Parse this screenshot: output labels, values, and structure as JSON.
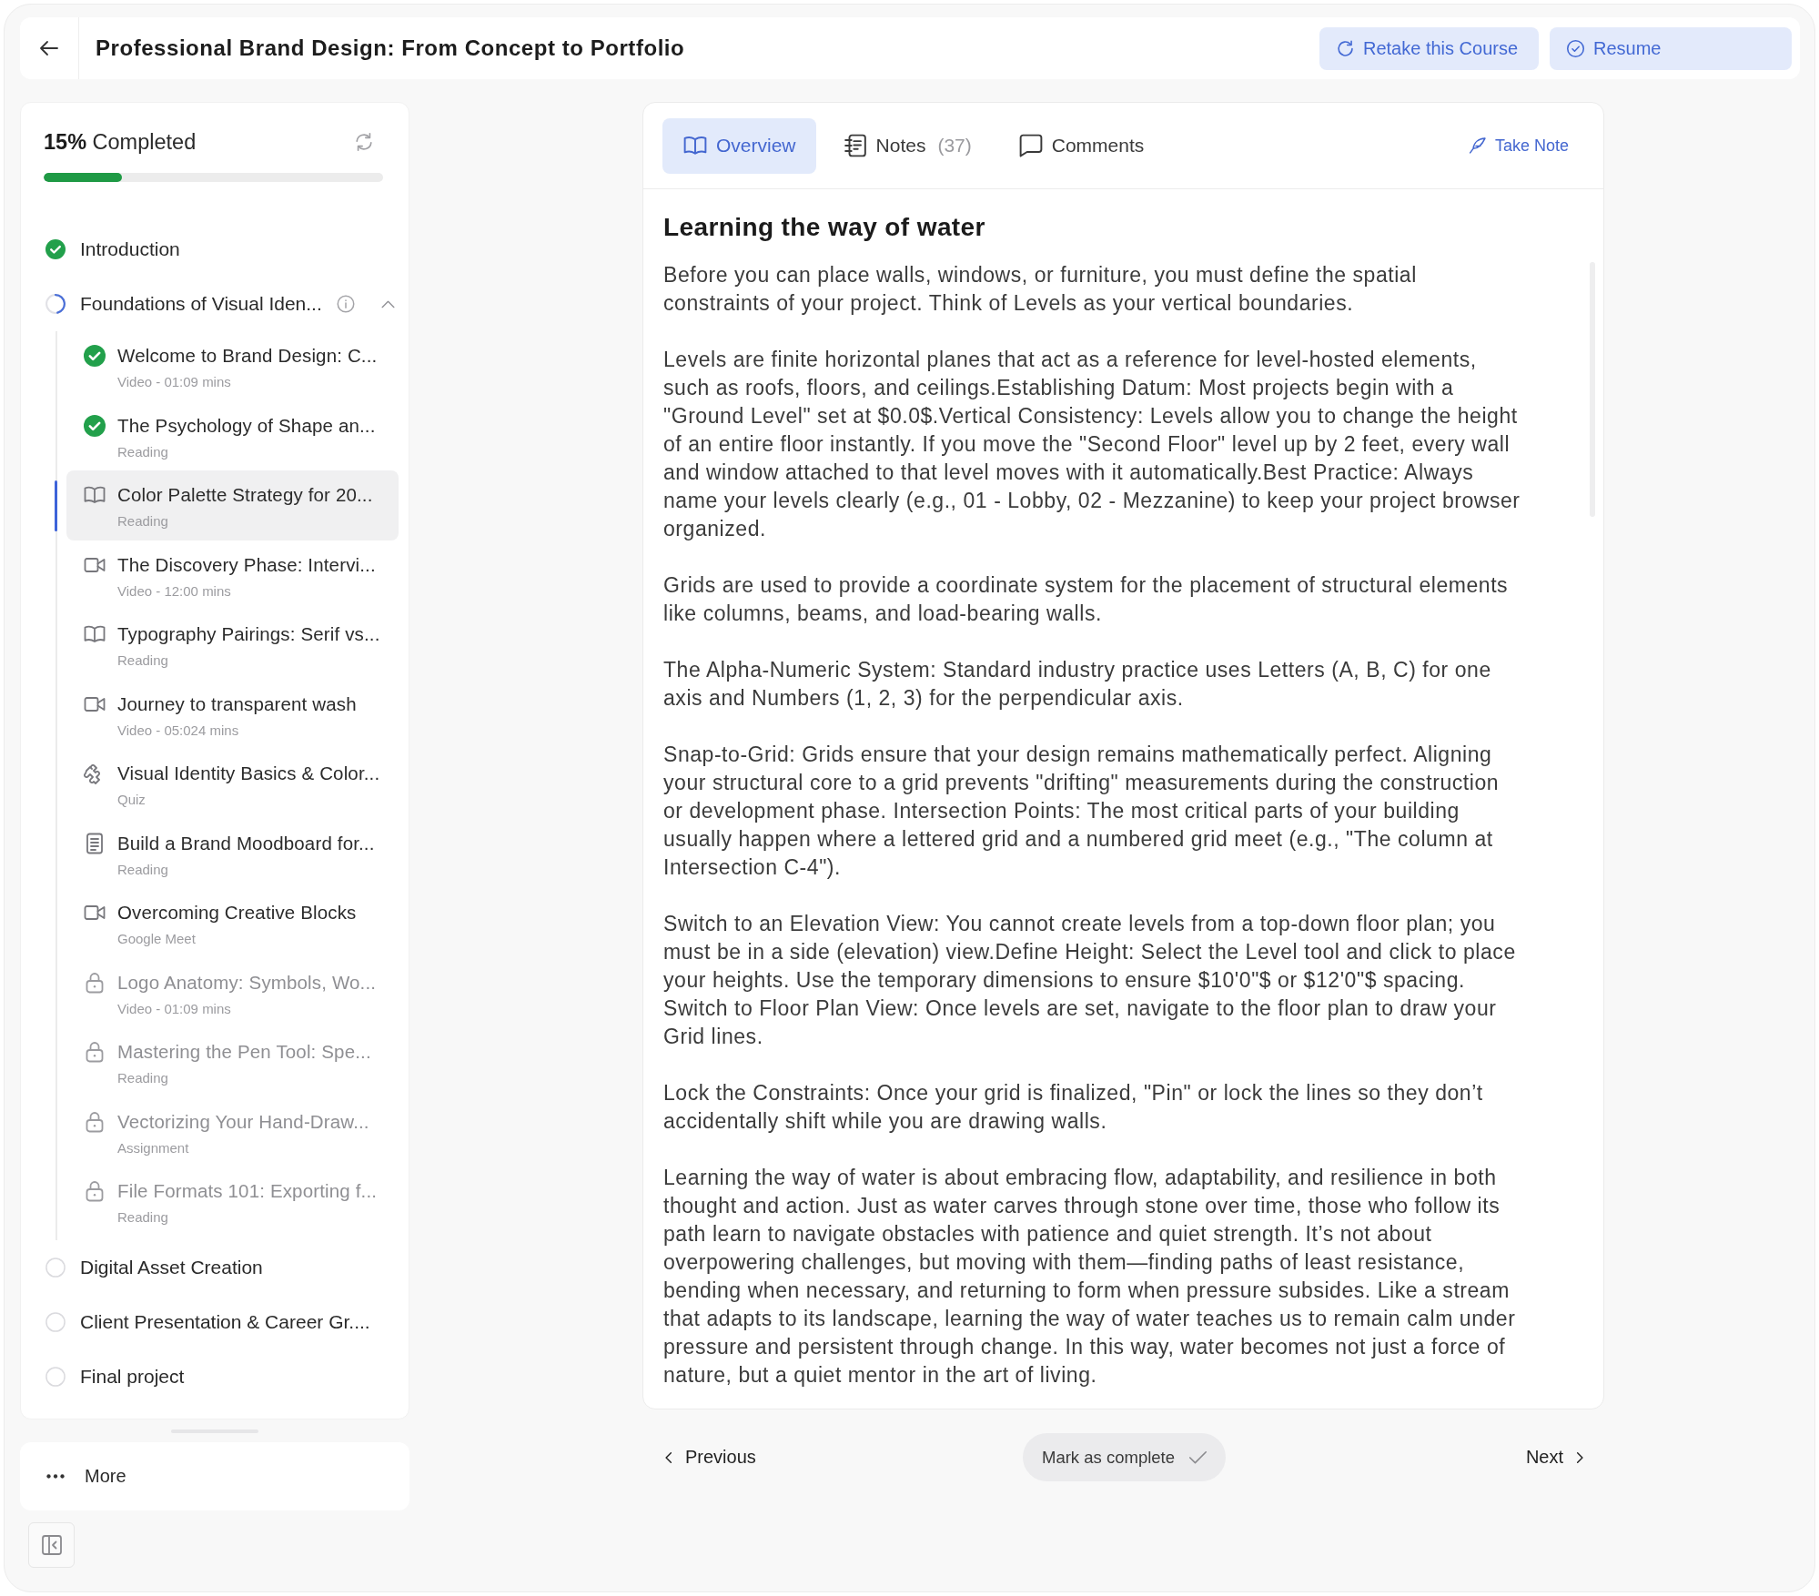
{
  "header": {
    "title": "Professional Brand Design: From Concept to Portfolio",
    "buttons": [
      "Retake this Course",
      "Resume"
    ]
  },
  "sidebar": {
    "progress": {
      "label": "**15%** Completed",
      "level": 0.23
    },
    "modules": [
      {
        "title": "Introduction",
        "kind": "complete"
      },
      {
        "title": "Foundations of Visual Iden...",
        "kind": "partial",
        "expanded": true,
        "lessons": [
          {
            "title": "Welcome to Brand Design: C...",
            "meta": "Video - 01:09 mins",
            "completed": true,
            "locked": false,
            "selected": false
          },
          {
            "title": "The Psychology of Shape an...",
            "meta": "Reading",
            "completed": true,
            "locked": false,
            "selected": false
          },
          {
            "title": "Color Palette Strategy for 20...",
            "meta": "Reading",
            "kind": "reading",
            "completed": false,
            "locked": false,
            "selected": true
          },
          {
            "title": "The Discovery Phase: Intervi...",
            "meta": "Video - 12:00 mins",
            "kind": "video",
            "completed": false,
            "locked": false,
            "selected": false
          },
          {
            "title": "Typography Pairings: Serif vs...",
            "meta": "Reading",
            "kind": "reading",
            "completed": false,
            "locked": false,
            "selected": false
          },
          {
            "title": "Journey to transparent wash",
            "meta": "Video - 05:024 mins",
            "kind": "video",
            "completed": false,
            "locked": false,
            "selected": false
          },
          {
            "title": "Visual Identity Basics & Color...",
            "meta": "Quiz",
            "kind": "quiz",
            "completed": false,
            "locked": false,
            "selected": false
          },
          {
            "title": "Build a Brand Moodboard for...",
            "meta": "Reading",
            "kind": "document",
            "completed": false,
            "locked": false,
            "selected": false
          },
          {
            "title": "Overcoming Creative Blocks",
            "meta": "Google Meet",
            "kind": "video",
            "completed": false,
            "locked": false,
            "selected": false
          },
          {
            "title": "Logo Anatomy: Symbols, Wo...",
            "meta": "Video - 01:09 mins",
            "completed": false,
            "locked": true,
            "selected": false
          },
          {
            "title": "Mastering the Pen Tool: Spe...",
            "meta": "Reading",
            "completed": false,
            "locked": true,
            "selected": false
          },
          {
            "title": "Vectorizing Your Hand-Draw...",
            "meta": "Assignment",
            "completed": false,
            "locked": true,
            "selected": false
          },
          {
            "title": "File Formats 101: Exporting f...",
            "meta": "Reading",
            "completed": false,
            "locked": true,
            "selected": false
          }
        ]
      },
      {
        "title": "Digital Asset Creation",
        "kind": "pending"
      },
      {
        "title": "Client Presentation & Career Gr....",
        "kind": "pending"
      },
      {
        "title": "Final project",
        "kind": "pending"
      }
    ],
    "more": "More"
  },
  "content": {
    "tabs": [
      {
        "label": "Overview",
        "selected": true
      },
      {
        "label": "Notes",
        "count": "(37)",
        "selected": false
      },
      {
        "label": "Comments",
        "selected": false
      }
    ],
    "take_note": "Take Note",
    "heading": "Learning the way of water",
    "paragraphs": [
      "Before you can place walls, windows, or furniture, you must define the spatial constraints of your project. Think of Levels as your vertical boundaries.",
      "Levels are finite horizontal planes that act as a reference for level-hosted elements, such as roofs, floors, and ceilings.Establishing Datum: Most projects begin with a \"Ground Level\" set at $0.0$.Vertical Consistency: Levels allow you to change the height of an entire floor instantly. If you move the \"Second Floor\" level up by 2 feet, every wall and window attached to that level moves with it automatically.Best Practice: Always name your levels clearly (e.g., 01 - Lobby, 02 - Mezzanine) to keep your project browser organized.",
      "Grids are used to provide a coordinate system for the placement of structural elements like columns, beams, and load-bearing walls.",
      "The Alpha-Numeric System: Standard industry practice uses Letters (A, B, C) for one axis and Numbers (1, 2, 3) for the perpendicular axis.",
      "Snap-to-Grid: Grids ensure that your design remains mathematically perfect. Aligning your structural core to a grid prevents \"drifting\" measurements during the construction or development phase. Intersection Points: The most critical parts of your building usually happen where a lettered grid and a numbered grid meet (e.g., \"The column at Intersection C-4\").",
      "Switch to an Elevation View: You cannot create levels from a top-down floor plan; you must be in a side (elevation) view.Define Height: Select the Level tool and click to place your heights. Use the temporary dimensions to ensure $10'0\"$ or $12'0\"$ spacing. Switch to Floor Plan View: Once levels are set, navigate to the floor plan to draw your Grid lines.",
      "Lock the Constraints: Once your grid is finalized, \"Pin\" or lock the lines so they don’t accidentally shift while you are drawing walls.",
      "Learning the way of water is about embracing flow, adaptability, and resilience in both thought and action. Just as water carves through stone over time, those who follow its path learn to navigate obstacles with patience and quiet strength. It’s not about overpowering challenges, but moving with them—finding paths of least resistance, bending when necessary, and returning to form when pressure subsides. Like a stream that adapts to its landscape, learning the way of water teaches us to remain calm under pressure and persistent through change. In this way, water becomes not just a force of nature, but a quiet mentor in the art of living."
    ]
  },
  "nav": {
    "previous": "Previous",
    "mark_complete": "Mark as complete",
    "next": "Next"
  }
}
